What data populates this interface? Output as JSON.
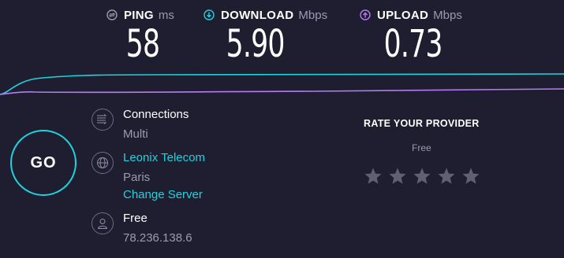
{
  "metrics": {
    "ping": {
      "label": "PING",
      "unit": "ms",
      "value": "58",
      "icon": "ping-icon",
      "color": "#9a9bb1"
    },
    "download": {
      "label": "DOWNLOAD",
      "unit": "Mbps",
      "value": "5.90",
      "icon": "download-arrow-icon",
      "color": "#1fd2dc"
    },
    "upload": {
      "label": "UPLOAD",
      "unit": "Mbps",
      "value": "0.73",
      "icon": "upload-arrow-icon",
      "color": "#b47cf0"
    }
  },
  "go_label": "GO",
  "connections": {
    "title": "Connections",
    "value": "Multi",
    "icon": "connections-icon"
  },
  "server": {
    "name": "Leonix Telecom",
    "location": "Paris",
    "change_label": "Change Server",
    "icon": "globe-icon"
  },
  "user": {
    "isp": "Free",
    "ip": "78.236.138.6",
    "icon": "user-icon"
  },
  "rate": {
    "title": "RATE YOUR PROVIDER",
    "provider": "Free",
    "stars_total": 5,
    "stars_filled": 0
  },
  "colors": {
    "background": "#1e1e30",
    "accent_cyan": "#1fd2dc",
    "accent_purple": "#b47cf0",
    "muted": "#9a9bb1",
    "star": "#5f6072"
  }
}
